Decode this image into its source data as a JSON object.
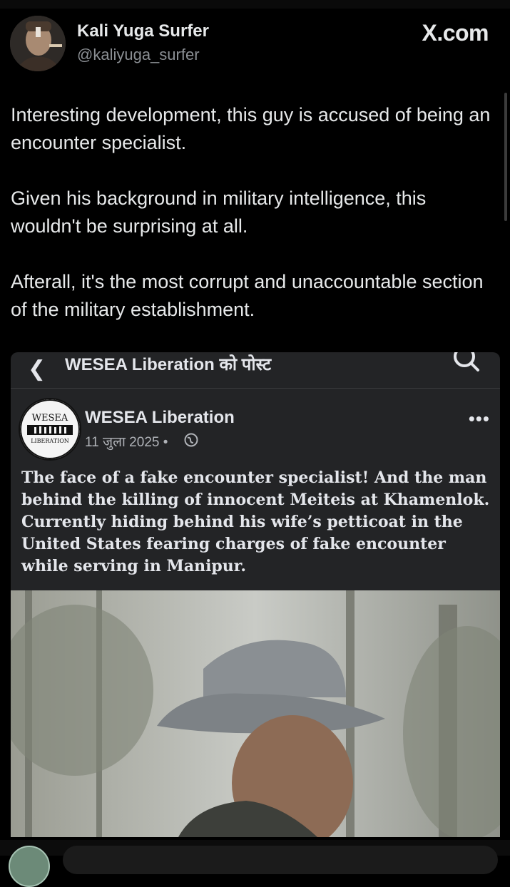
{
  "author": {
    "name": "Kali Yuga Surfer",
    "handle": "@kaliyuga_surfer",
    "avatar_icon": "profile-photo-icon"
  },
  "brand": {
    "logo": "X.com"
  },
  "tweet": {
    "paragraphs": [
      "Interesting development, this guy is accused of being an encounter specialist.",
      "Given his background in military intelligence, this wouldn't be surprising at all.",
      "Afterall, it's the most corrupt and unaccountable section of the military establishment."
    ]
  },
  "embedded_post": {
    "header_title": "WESEA Liberation को पोस्ट",
    "page_name": "WESEA Liberation",
    "date": "11 जुला 2025 • ",
    "logo_text_top": "WESEA",
    "logo_text_bottom": "LIBERATION",
    "text": "The face of a fake encounter specialist! And the man behind the killing of innocent Meiteis at Khamenlok. Currently hiding behind his wife’s petticoat in the United States fearing charges of fake encounter while serving in Manipur.",
    "more_label": "•••"
  },
  "colors": {
    "background": "#000000",
    "card": "#232426",
    "text": "#e7e9ea",
    "muted": "#8b8f94"
  }
}
